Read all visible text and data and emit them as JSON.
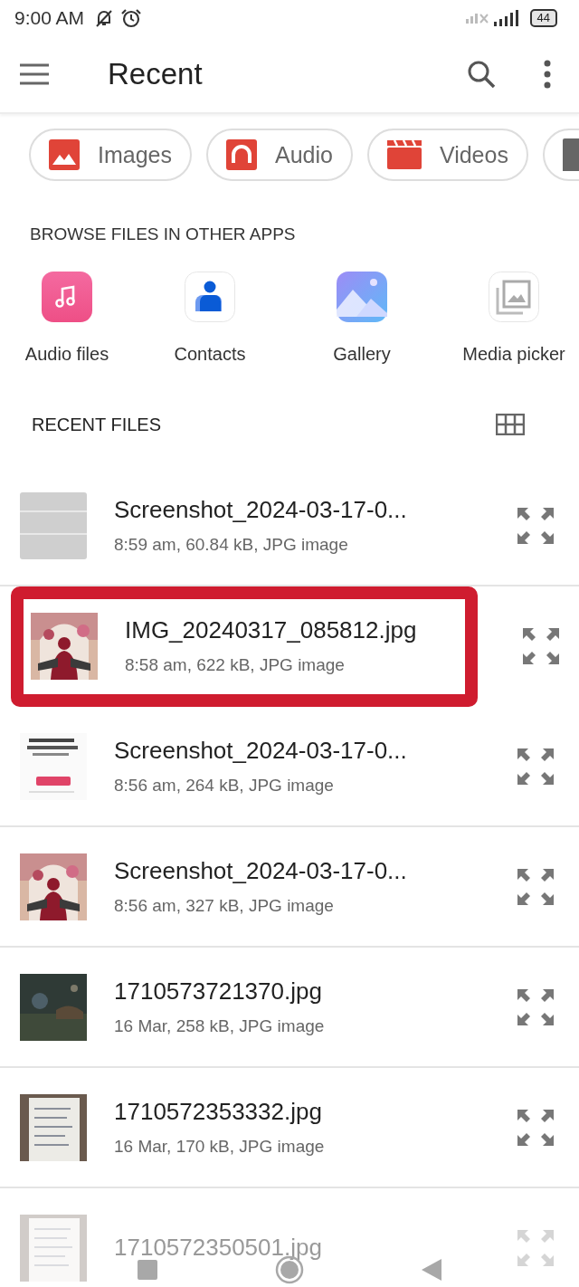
{
  "status_bar": {
    "time": "9:00 AM",
    "battery": "44"
  },
  "app_bar": {
    "title": "Recent"
  },
  "chips": [
    {
      "label": "Images",
      "kind": "images"
    },
    {
      "label": "Audio",
      "kind": "audio"
    },
    {
      "label": "Videos",
      "kind": "videos"
    },
    {
      "kind": "documents"
    }
  ],
  "browse_section": {
    "heading": "BROWSE FILES IN OTHER APPS",
    "apps": [
      {
        "label": "Audio files",
        "kind": "music"
      },
      {
        "label": "Contacts",
        "kind": "contacts"
      },
      {
        "label": "Gallery",
        "kind": "gallery"
      },
      {
        "label": "Media picker",
        "kind": "media"
      }
    ]
  },
  "recent_section": {
    "heading": "RECENT FILES",
    "files": [
      {
        "name": "Screenshot_2024-03-17-0...",
        "details": "8:59 am, 60.84 kB, JPG image",
        "kind": "placeholder",
        "highlighted": false
      },
      {
        "name": "IMG_20240317_085812.jpg",
        "details": "8:58 am, 622 kB, JPG image",
        "kind": "picture",
        "highlighted": true
      },
      {
        "name": "Screenshot_2024-03-17-0...",
        "details": "8:56 am, 264 kB, JPG image",
        "kind": "picture",
        "highlighted": false
      },
      {
        "name": "Screenshot_2024-03-17-0...",
        "details": "8:56 am, 327 kB, JPG image",
        "kind": "picture",
        "highlighted": false
      },
      {
        "name": "1710573721370.jpg",
        "details": "16 Mar, 258 kB, JPG image",
        "kind": "picture",
        "highlighted": false
      },
      {
        "name": "1710572353332.jpg",
        "details": "16 Mar, 170 kB, JPG image",
        "kind": "picture",
        "highlighted": false
      },
      {
        "name": "1710572350501.jpg",
        "kind": "picture",
        "highlighted": false
      }
    ]
  }
}
